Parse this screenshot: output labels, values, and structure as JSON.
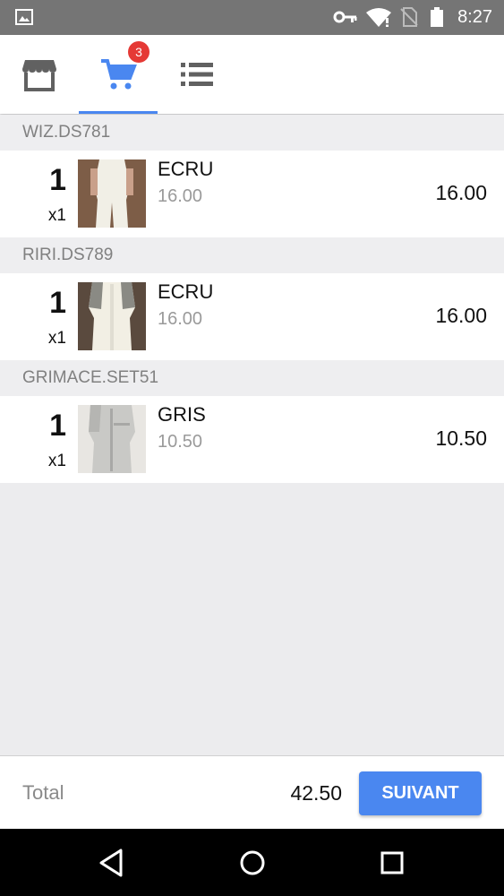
{
  "status_bar": {
    "time": "8:27",
    "icons": [
      "image-icon",
      "key-icon",
      "wifi-icon",
      "no-sim-icon",
      "battery-icon"
    ]
  },
  "tabs": [
    {
      "name": "store",
      "icon": "storefront-icon"
    },
    {
      "name": "cart",
      "icon": "cart-icon",
      "badge": "3",
      "active": true
    },
    {
      "name": "list",
      "icon": "list-icon"
    }
  ],
  "accent_color": "#4a87f0",
  "cart": {
    "groups": [
      {
        "header": "WIZ.DS781",
        "qty": "1",
        "mult": "x1",
        "name": "ECRU",
        "unit_price": "16.00",
        "price": "16.00"
      },
      {
        "header": "RIRI.DS789",
        "qty": "1",
        "mult": "x1",
        "name": "ECRU",
        "unit_price": "16.00",
        "price": "16.00"
      },
      {
        "header": "GRIMACE.SET51",
        "qty": "1",
        "mult": "x1",
        "name": "GRIS",
        "unit_price": "10.50",
        "price": "10.50"
      }
    ]
  },
  "footer": {
    "total_label": "Total",
    "total_value": "42.50",
    "next_label": "SUIVANT"
  },
  "nav": [
    "back-icon",
    "home-icon",
    "recents-icon"
  ]
}
